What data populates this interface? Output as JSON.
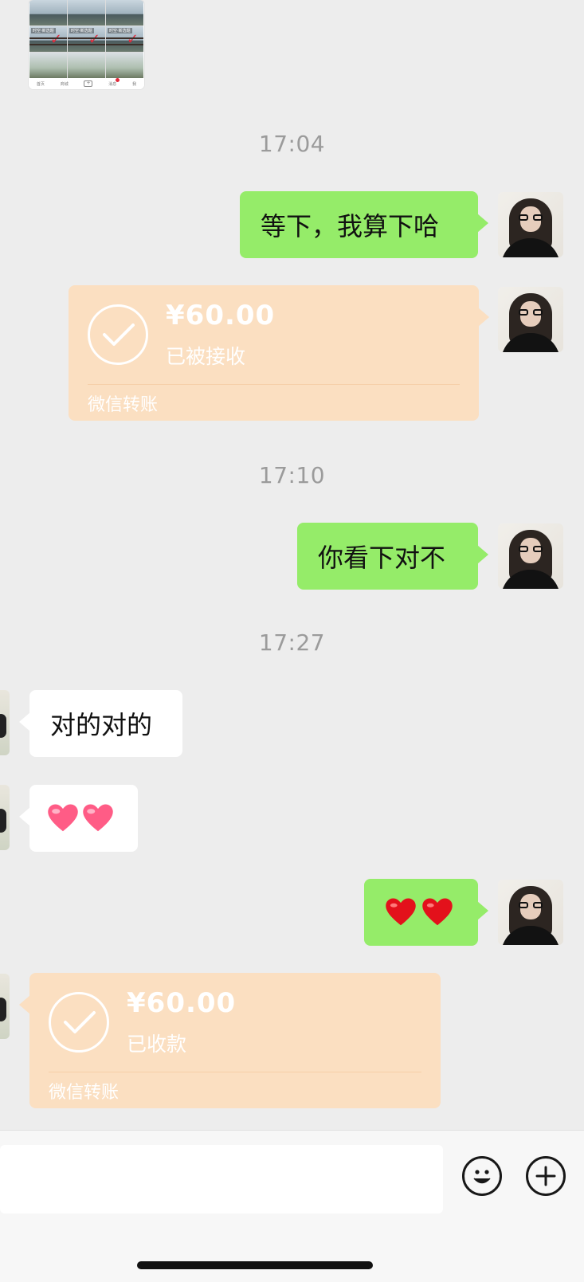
{
  "image_thumbnail": {
    "tag": "时空·新选题",
    "bottom_tabs": [
      "首页",
      "商城",
      "+",
      "消息",
      "我"
    ]
  },
  "timestamps": [
    "17:04",
    "17:10",
    "17:27"
  ],
  "messages": [
    {
      "text": "等下，我算下哈"
    },
    {
      "text": "你看下对不"
    },
    {
      "text": "对的对的"
    }
  ],
  "transfers": [
    {
      "amount": "¥60.00",
      "status": "已被接收",
      "footer": "微信转账"
    },
    {
      "amount": "¥60.00",
      "status": "已收款",
      "footer": "微信转账"
    }
  ],
  "emoji_messages": {
    "theirs": "pink-heart-emoji x2",
    "mine": "red-heart-emoji x2"
  },
  "input_bar": {
    "emoji_button_icon": "smiley-icon",
    "more_button_icon": "plus-circle-icon"
  },
  "colors": {
    "background": "#ededed",
    "my_bubble": "#95ec69",
    "their_bubble": "#ffffff",
    "transfer_card": "#fbdfc1",
    "timestamp": "#9b9b9b"
  }
}
